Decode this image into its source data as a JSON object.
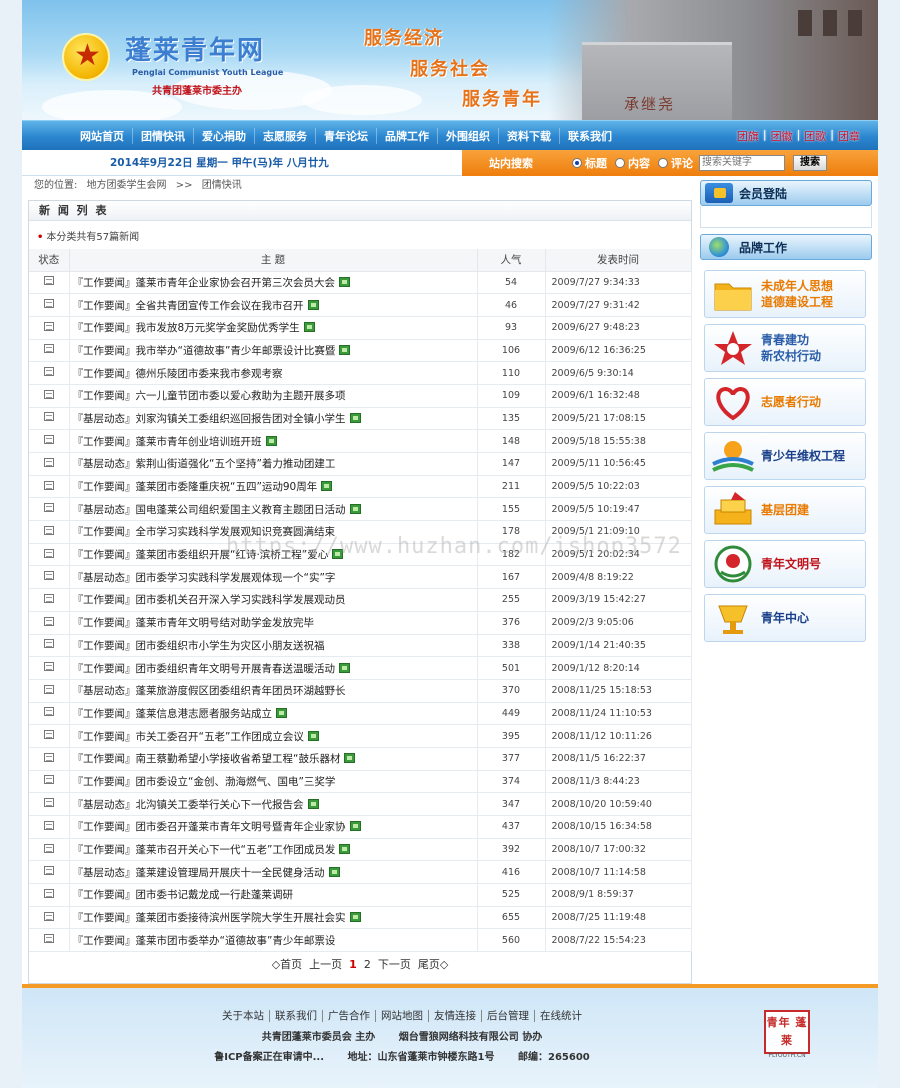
{
  "header": {
    "logo_cn": "蓬莱青年网",
    "logo_en": "Penglai Communist Youth League",
    "logo_sub": "共青团蓬莱市委主办",
    "slogans": [
      "服务经济",
      "服务社会",
      "服务青年"
    ],
    "carving": "承继尧"
  },
  "nav": {
    "items": [
      "网站首页",
      "团情快讯",
      "爱心捐助",
      "志愿服务",
      "青年论坛",
      "品牌工作",
      "外围组织",
      "资料下载",
      "联系我们"
    ],
    "right": [
      "团旗",
      "团徽",
      "团歌",
      "团章"
    ]
  },
  "datebar": {
    "date": "2014年9月22日  星期一  甲午(马)年  八月廿九",
    "search_label": "站内搜索",
    "radios": [
      "标题",
      "内容",
      "评论"
    ],
    "selected_radio": "标题",
    "search_placeholder": "搜索关键字",
    "search_button": "搜索"
  },
  "breadcrumb": [
    "您的位置:",
    "地方团委学生会网",
    ">>",
    "团情快讯"
  ],
  "news": {
    "title": "新 闻 列 表",
    "note_bullet": "•",
    "note": "本分类共有57篇新闻",
    "columns": [
      "状态",
      "主 题",
      "人气",
      "发表时间"
    ],
    "rows": [
      {
        "cat": "『工作要闻』",
        "title": "蓬莱市青年企业家协会召开第三次会员大会",
        "hits": "54",
        "time": "2009/7/27 9:34:33",
        "new": true
      },
      {
        "cat": "『工作要闻』",
        "title": "全省共青团宣传工作会议在我市召开",
        "hits": "46",
        "time": "2009/7/27 9:31:42",
        "new": true
      },
      {
        "cat": "『工作要闻』",
        "title": "我市发放8万元奖学金奖励优秀学生",
        "hits": "93",
        "time": "2009/6/27 9:48:23",
        "new": true
      },
      {
        "cat": "『工作要闻』",
        "title": "我市举办“道德故事”青少年邮票设计比赛暨",
        "hits": "106",
        "time": "2009/6/12 16:36:25",
        "new": true
      },
      {
        "cat": "『工作要闻』",
        "title": "德州乐陵团市委来我市参观考察",
        "hits": "110",
        "time": "2009/6/5 9:30:14",
        "new": false
      },
      {
        "cat": "『工作要闻』",
        "title": "六一儿童节团市委以爱心救助为主题开展多项",
        "hits": "109",
        "time": "2009/6/1 16:32:48",
        "new": false
      },
      {
        "cat": "『基层动态』",
        "title": "刘家沟镇关工委组织巡回报告团对全镇小学生",
        "hits": "135",
        "time": "2009/5/21 17:08:15",
        "new": true
      },
      {
        "cat": "『工作要闻』",
        "title": "蓬莱市青年创业培训班开班",
        "hits": "148",
        "time": "2009/5/18 15:55:38",
        "new": true
      },
      {
        "cat": "『基层动态』",
        "title": "紫荆山街道强化“五个坚持”着力推动团建工",
        "hits": "147",
        "time": "2009/5/11 10:56:45",
        "new": false
      },
      {
        "cat": "『工作要闻』",
        "title": "蓬莱团市委隆重庆祝“五四”运动90周年",
        "hits": "211",
        "time": "2009/5/5 10:22:03",
        "new": true
      },
      {
        "cat": "『基层动态』",
        "title": "国电蓬莱公司组织爱国主义教育主题团日活动",
        "hits": "155",
        "time": "2009/5/5 10:19:47",
        "new": true
      },
      {
        "cat": "『工作要闻』",
        "title": "全市学习实践科学发展观知识竞赛圆满结束",
        "hits": "178",
        "time": "2009/5/1 21:09:10",
        "new": false
      },
      {
        "cat": "『工作要闻』",
        "title": "蓬莱团市委组织开展“红诗·滨桥工程”爱心",
        "hits": "182",
        "time": "2009/5/1 20:02:34",
        "new": true
      },
      {
        "cat": "『基层动态』",
        "title": "团市委学习实践科学发展观体现一个“实”字",
        "hits": "167",
        "time": "2009/4/8 8:19:22",
        "new": false
      },
      {
        "cat": "『工作要闻』",
        "title": "团市委机关召开深入学习实践科学发展观动员",
        "hits": "255",
        "time": "2009/3/19 15:42:27",
        "new": false
      },
      {
        "cat": "『工作要闻』",
        "title": "蓬莱市青年文明号结对助学金发放完毕",
        "hits": "376",
        "time": "2009/2/3 9:05:06",
        "new": false
      },
      {
        "cat": "『工作要闻』",
        "title": "团市委组织市小学生为灾区小朋友送祝福",
        "hits": "338",
        "time": "2009/1/14 21:40:35",
        "new": false
      },
      {
        "cat": "『工作要闻』",
        "title": "团市委组织青年文明号开展青春送温暖活动",
        "hits": "501",
        "time": "2009/1/12 8:20:14",
        "new": true
      },
      {
        "cat": "『基层动态』",
        "title": "蓬莱旅游度假区团委组织青年团员环湖越野长",
        "hits": "370",
        "time": "2008/11/25 15:18:53",
        "new": false
      },
      {
        "cat": "『工作要闻』",
        "title": "蓬莱信息港志愿者服务站成立",
        "hits": "449",
        "time": "2008/11/24 11:10:53",
        "new": true
      },
      {
        "cat": "『工作要闻』",
        "title": "市关工委召开“五老”工作团成立会议",
        "hits": "395",
        "time": "2008/11/12 10:11:26",
        "new": true
      },
      {
        "cat": "『工作要闻』",
        "title": "南王蔡勤希望小学接收省希望工程“鼓乐器材",
        "hits": "377",
        "time": "2008/11/5 16:22:37",
        "new": true
      },
      {
        "cat": "『工作要闻』",
        "title": "团市委设立“金创、渤海燃气、国电”三奖学",
        "hits": "374",
        "time": "2008/11/3 8:44:23",
        "new": false
      },
      {
        "cat": "『基层动态』",
        "title": "北沟镇关工委举行关心下一代报告会",
        "hits": "347",
        "time": "2008/10/20 10:59:40",
        "new": true
      },
      {
        "cat": "『工作要闻』",
        "title": "团市委召开蓬莱市青年文明号暨青年企业家协",
        "hits": "437",
        "time": "2008/10/15 16:34:58",
        "new": true
      },
      {
        "cat": "『工作要闻』",
        "title": "蓬莱市召开关心下一代“五老”工作团成员发",
        "hits": "392",
        "time": "2008/10/7 17:00:32",
        "new": true
      },
      {
        "cat": "『基层动态』",
        "title": "蓬莱建设管理局开展庆十一全民健身活动",
        "hits": "416",
        "time": "2008/10/7 11:14:58",
        "new": true
      },
      {
        "cat": "『工作要闻』",
        "title": "团市委书记戴龙成一行赴蓬莱调研",
        "hits": "525",
        "time": "2008/9/1 8:59:37",
        "new": false
      },
      {
        "cat": "『工作要闻』",
        "title": "蓬莱团市委接待滨州医学院大学生开展社会实",
        "hits": "655",
        "time": "2008/7/25 11:19:48",
        "new": true
      },
      {
        "cat": "『工作要闻』",
        "title": "蓬莱市团市委举办“道德故事”青少年邮票设",
        "hits": "560",
        "time": "2008/7/22 15:54:23",
        "new": false
      }
    ],
    "pager": {
      "first": "◇首页",
      "prev": "上一页",
      "pages": [
        "1",
        "2"
      ],
      "current": "1",
      "next": "下一页",
      "last": "尾页◇"
    }
  },
  "watermark": "https://www.huzhan.com/ishop3572",
  "sidebar": {
    "login_title": "会员登陆",
    "brand_title": "品牌工作",
    "brands": [
      {
        "lines": [
          "未成年人思想",
          "道德建设工程"
        ],
        "color": "#e97a00",
        "icon": "folder-icon"
      },
      {
        "lines": [
          "青春建功",
          "新农村行动"
        ],
        "color": "#2a5da8",
        "icon": "star-icon"
      },
      {
        "lines": [
          "志愿者行动"
        ],
        "color": "#e97a00",
        "icon": "heart-icon"
      },
      {
        "lines": [
          "青少年维权工程"
        ],
        "color": "#1a3f8a",
        "icon": "sun-wave-icon"
      },
      {
        "lines": [
          "基层团建"
        ],
        "color": "#e97a00",
        "icon": "blocks-icon"
      },
      {
        "lines": [
          "青年文明号"
        ],
        "color": "#c0121a",
        "icon": "emblem-icon"
      },
      {
        "lines": [
          "青年中心"
        ],
        "color": "#1a3f8a",
        "icon": "cup-icon"
      }
    ]
  },
  "footer": {
    "links": [
      "关于本站",
      "联系我们",
      "广告合作",
      "网站地图",
      "友情连接",
      "后台管理",
      "在线统计"
    ],
    "line1": [
      "共青团蓬莱市委员会  主办",
      "烟台雪狼网络科技有限公司  协办"
    ],
    "line2": [
      "鲁ICP备案正在审请中...",
      "地址：山东省蓬莱市钟楼东路1号",
      "邮编：265600"
    ],
    "stamp": "青年 蓬莱",
    "stamp_en": "PLYOUTH.CN"
  }
}
